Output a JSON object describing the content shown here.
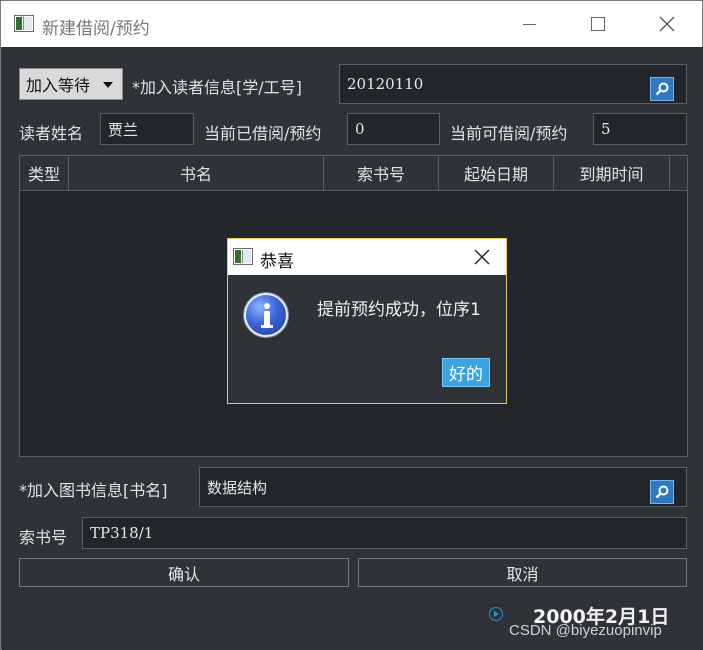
{
  "window": {
    "title": "新建借阅/预约"
  },
  "form": {
    "mode_combo_value": "加入等待",
    "reader_label": "*加入读者信息[学/工号]",
    "reader_id": "20120110",
    "name_label": "读者姓名",
    "name_value": "贾兰",
    "current_borrowed_label": "当前已借阅/预约",
    "current_borrowed_value": "0",
    "available_label": "当前可借阅/预约",
    "available_value": "5",
    "book_label": "*加入图书信息[书名]",
    "book_value": "数据结构",
    "callno_label": "索书号",
    "callno_value": "TP318/1",
    "confirm_label": "确认",
    "cancel_label": "取消"
  },
  "table": {
    "columns": [
      "类型",
      "书名",
      "索书号",
      "起始日期",
      "到期时间"
    ],
    "rows": []
  },
  "dialog": {
    "title": "恭喜",
    "message": "提前预约成功，位序1",
    "ok_label": "好的"
  },
  "footer": {
    "date": "2000年2月1日",
    "watermark": "CSDN @biyezuopinvip"
  },
  "colors": {
    "window_bg": "#2f3338",
    "input_bg": "#22262a",
    "accent_button": "#3aa4e3",
    "search_button": "#2f78c4",
    "dialog_border": "#e5c95a"
  },
  "icons": {
    "app": "app-window-icon",
    "search": "search-icon",
    "info": "info-icon",
    "close": "close-icon",
    "play": "play-circle-icon"
  }
}
